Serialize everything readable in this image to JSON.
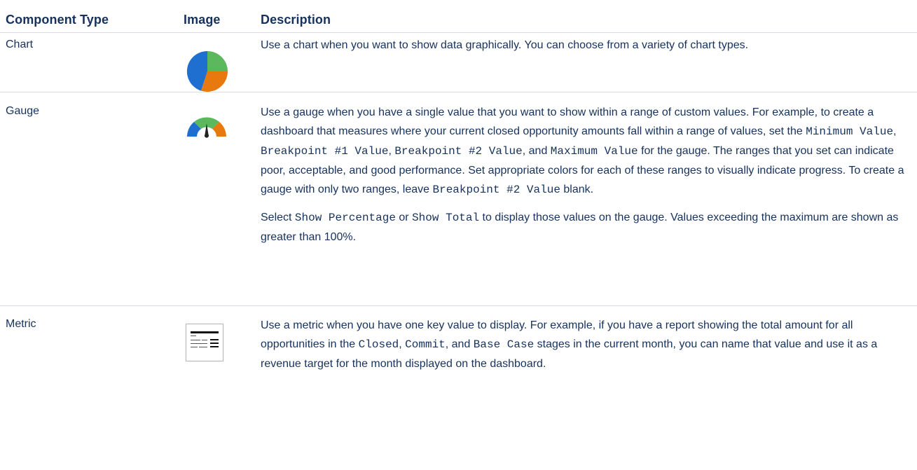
{
  "table": {
    "headers": {
      "component_type": "Component Type",
      "image": "Image",
      "description": "Description"
    },
    "rows": {
      "chart": {
        "type": "Chart",
        "icon": "pie-chart-icon",
        "p1": "Use a chart when you want to show data graphically. You can choose from a variety of chart types."
      },
      "gauge": {
        "type": "Gauge",
        "icon": "gauge-icon",
        "p1_a": "Use a gauge when you have a single value that you want to show within a range of custom values. For example, to create a dashboard that measures where your current closed opportunity amounts fall within a range of values, set the ",
        "code_min": "Minimum Value",
        "sep1": ", ",
        "code_bp1": "Breakpoint #1 Value",
        "sep2": ", ",
        "code_bp2": "Breakpoint #2 Value",
        "sep3": ", and ",
        "code_max": "Maximum Value",
        "p1_b": " for the gauge. The ranges that you set can indicate poor, acceptable, and good performance. Set appropriate colors for each of these ranges to visually indicate progress. To create a gauge with only two ranges, leave ",
        "code_bp2b": "Breakpoint #2 Value",
        "p1_c": " blank.",
        "p2_a": "Select ",
        "code_pct": "Show Percentage",
        "p2_or": " or ",
        "code_total": "Show Total",
        "p2_b": " to display those values on the gauge. Values exceeding the maximum are shown as greater than 100%."
      },
      "metric": {
        "type": "Metric",
        "icon": "metric-icon",
        "p1_a": "Use a metric when you have one key value to display. For example, if you have a report showing the total amount for all opportunities in the ",
        "code_closed": "Closed",
        "sep1": ", ",
        "code_commit": "Commit",
        "sep2": ", and ",
        "code_base": "Base Case",
        "p1_b": " stages in the current month, you can name that value and use it as a revenue target for the month displayed on the dashboard."
      }
    }
  },
  "colors": {
    "text": "#16325c",
    "divider": "#d8dde6",
    "pie_blue": "#1f6fd0",
    "pie_green": "#5cb85c",
    "pie_orange": "#e8790f"
  }
}
